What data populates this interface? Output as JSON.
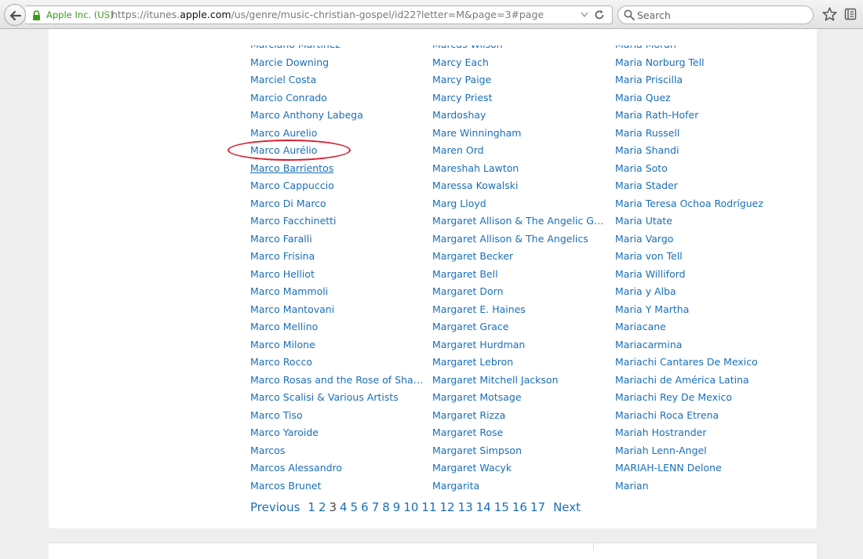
{
  "browser": {
    "identity": "Apple Inc. (US)",
    "url_prefix": "https://itunes.",
    "url_host": "apple.com",
    "url_path": "/us/genre/music-christian-gospel/id22?letter=M&page=3#page",
    "search_placeholder": "Search"
  },
  "artists": {
    "column1": [
      "Marciano Martinez",
      "Marcie Downing",
      "Marciel Costa",
      "Marcio Conrado",
      "Marco Anthony Labega",
      "Marco Aurelio",
      "Marco Aurélio",
      "Marco Barrientos",
      "Marco Cappuccio",
      "Marco Di Marco",
      "Marco Facchinetti",
      "Marco Faralli",
      "Marco Frisina",
      "Marco Helliot",
      "Marco Mammoli",
      "Marco Mantovani",
      "Marco Mellino",
      "Marco Milone",
      "Marco Rocco",
      "Marco Rosas and the Rose of Sharon",
      "Marco Scalisi & Various Artists",
      "Marco Tiso",
      "Marco Yaroide",
      "Marcos",
      "Marcos Alessandro",
      "Marcos Brunet"
    ],
    "column2": [
      "Marcus Wilson",
      "Marcy Each",
      "Marcy Paige",
      "Marcy Priest",
      "Mardoshay",
      "Mare Winningham",
      "Maren Ord",
      "Mareshah Lawton",
      "Maressa Kowalski",
      "Marg Lloyd",
      "Margaret Allison & The Angelic Gospel Singers",
      "Margaret Allison & The Angelics",
      "Margaret Becker",
      "Margaret Bell",
      "Margaret Dorn",
      "Margaret E. Haines",
      "Margaret Grace",
      "Margaret Hurdman",
      "Margaret Lebron",
      "Margaret Mitchell Jackson",
      "Margaret Motsage",
      "Margaret Rizza",
      "Margaret Rose",
      "Margaret Simpson",
      "Margaret Wacyk",
      "Margarita"
    ],
    "column3": [
      "Maria Moran",
      "Maria Norburg Tell",
      "Maria Priscilla",
      "Maria Quez",
      "Maria Rath-Hofer",
      "Maria Russell",
      "Maria Shandi",
      "Maria Soto",
      "Maria Stader",
      "Maria Teresa Ochoa Rodríguez",
      "Maria Utate",
      "Maria Vargo",
      "Maria von Tell",
      "Maria Williford",
      "Maria y Alba",
      "Maria Y Martha",
      "Mariacane",
      "Mariacarmina",
      "Mariachi Cantares De Mexico",
      "Mariachi de América Latina",
      "Mariachi Rey De Mexico",
      "Mariachi Roca Etrena",
      "Mariah Hostrander",
      "Mariah Lenn-Angel",
      "MARIAH-LENN Delone",
      "Marian"
    ]
  },
  "pagination": {
    "previous": "Previous",
    "pages": [
      "1",
      "2",
      "3",
      "4",
      "5",
      "6",
      "7",
      "8",
      "9",
      "10",
      "11",
      "12",
      "13",
      "14",
      "15",
      "16",
      "17"
    ],
    "current": "3",
    "next": "Next"
  },
  "highlighted_artist": "Marco Barrientos",
  "colors": {
    "link": "#1a6fb8",
    "annotation": "#d8202f",
    "secure_identity": "#3c9b1f"
  }
}
